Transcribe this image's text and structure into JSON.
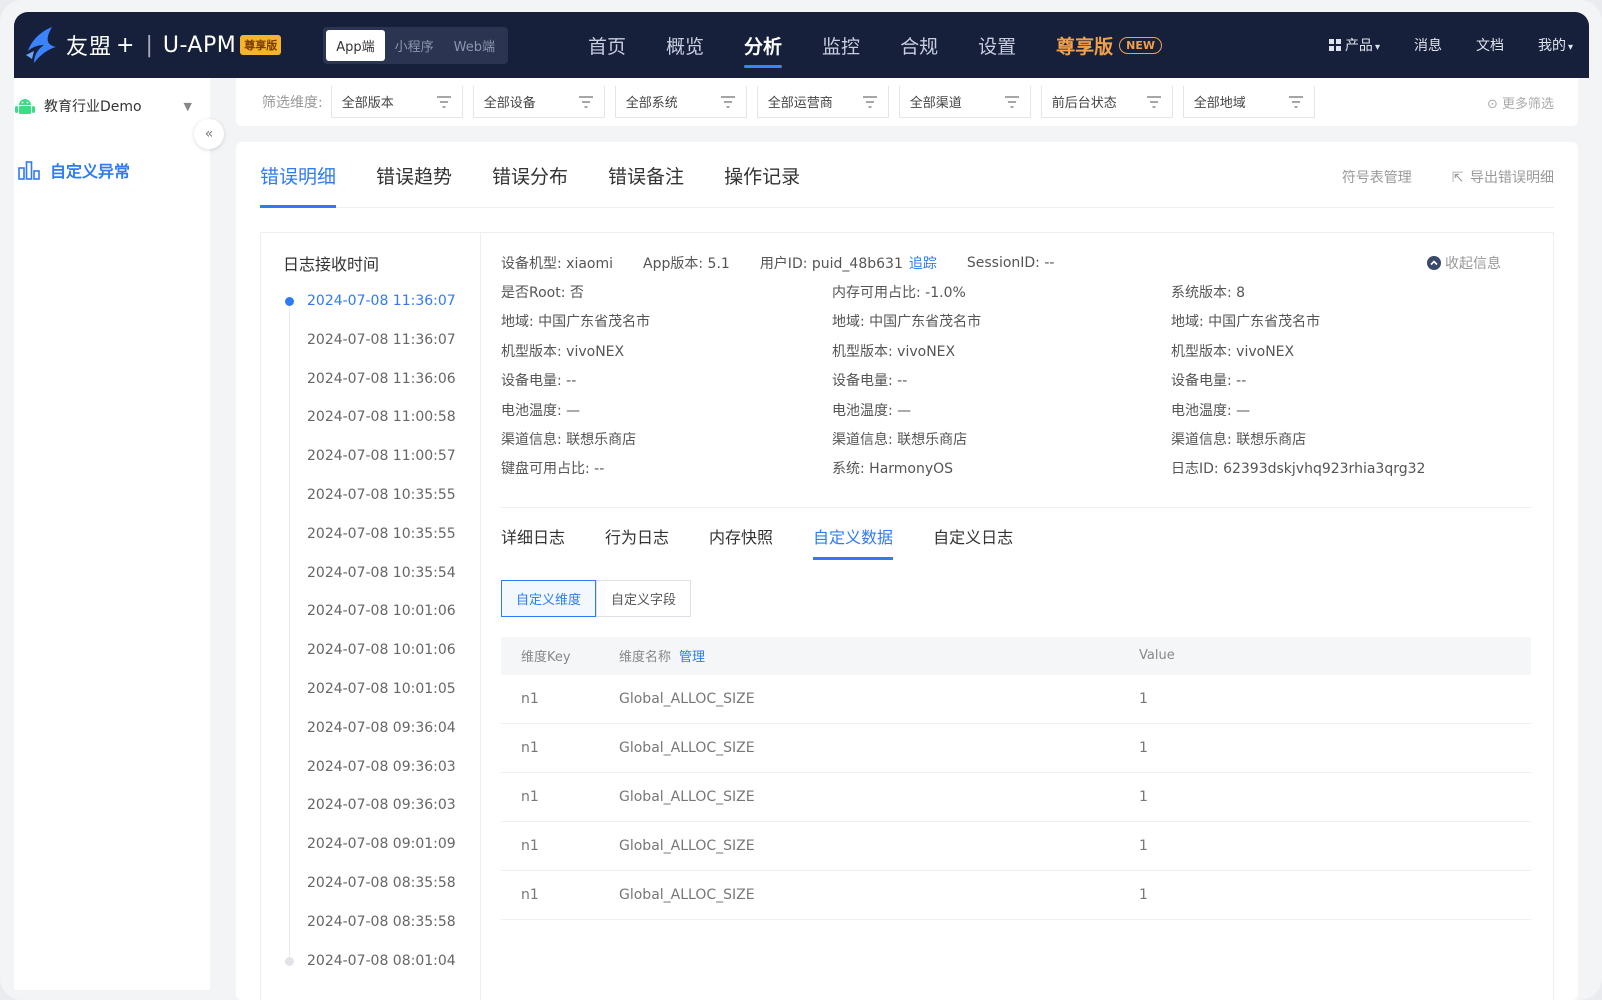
{
  "brand": {
    "name": "友盟",
    "plus": "+",
    "product": "U-APM",
    "badge": "尊享版"
  },
  "platforms": [
    "App端",
    "小程序",
    "Web端"
  ],
  "nav": {
    "items": [
      "首页",
      "概览",
      "分析",
      "监控",
      "合规",
      "设置"
    ],
    "vip": "尊享版",
    "vip_badge": "NEW",
    "right": [
      "产品",
      "消息",
      "文档",
      "我的"
    ]
  },
  "sidebar": {
    "app_name": "教育行业Demo",
    "menu_item": "自定义异常"
  },
  "filters": {
    "label": "筛选维度:",
    "items": [
      "全部版本",
      "全部设备",
      "全部系统",
      "全部运营商",
      "全部渠道",
      "前后台状态",
      "全部地域"
    ],
    "more": "更多筛选"
  },
  "tabs": {
    "items": [
      "错误明细",
      "错误趋势",
      "错误分布",
      "错误备注",
      "操作记录"
    ],
    "actions": [
      "符号表管理",
      "导出错误明细"
    ]
  },
  "time_list": {
    "title": "日志接收时间",
    "items": [
      "2024-07-08 11:36:07",
      "2024-07-08 11:36:07",
      "2024-07-08 11:36:06",
      "2024-07-08 11:00:58",
      "2024-07-08 11:00:57",
      "2024-07-08 10:35:55",
      "2024-07-08 10:35:55",
      "2024-07-08 10:35:54",
      "2024-07-08 10:01:06",
      "2024-07-08 10:01:06",
      "2024-07-08 10:01:05",
      "2024-07-08 09:36:04",
      "2024-07-08 09:36:03",
      "2024-07-08 09:36:03",
      "2024-07-08 09:01:09",
      "2024-07-08 08:35:58",
      "2024-07-08 08:35:58",
      "2024-07-08 08:01:04"
    ]
  },
  "detail": {
    "device_model": "设备机型: xiaomi",
    "app_version": "App版本: 5.1",
    "user_id": "用户ID: puid_48b631",
    "trace": "追踪",
    "session_id": "SessionID: --",
    "collapse": "收起信息",
    "grid": [
      "是否Root: 否",
      "内存可用占比: -1.0%",
      "系统版本: 8",
      "地域: 中国广东省茂名市",
      "地域: 中国广东省茂名市",
      "地域: 中国广东省茂名市",
      "机型版本: vivoNEX",
      "机型版本: vivoNEX",
      "机型版本: vivoNEX",
      "设备电量: --",
      "设备电量: --",
      "设备电量: --",
      "电池温度: —",
      "电池温度: —",
      "电池温度: —",
      "渠道信息: 联想乐商店",
      "渠道信息: 联想乐商店",
      "渠道信息: 联想乐商店",
      "键盘可用占比: --",
      "系统: HarmonyOS",
      "日志ID: 62393dskjvhq923rhia3qrg32"
    ]
  },
  "sub_tabs": [
    "详细日志",
    "行为日志",
    "内存快照",
    "自定义数据",
    "自定义日志"
  ],
  "segment": [
    "自定义维度",
    "自定义字段"
  ],
  "table": {
    "headers": {
      "key": "维度Key",
      "name": "维度名称",
      "manage": "管理",
      "value": "Value"
    },
    "rows": [
      {
        "key": "n1",
        "name": "Global_ALLOC_SIZE",
        "value": "1"
      },
      {
        "key": "n1",
        "name": "Global_ALLOC_SIZE",
        "value": "1"
      },
      {
        "key": "n1",
        "name": "Global_ALLOC_SIZE",
        "value": "1"
      },
      {
        "key": "n1",
        "name": "Global_ALLOC_SIZE",
        "value": "1"
      },
      {
        "key": "n1",
        "name": "Global_ALLOC_SIZE",
        "value": "1"
      }
    ]
  },
  "colors": {
    "brand_nav": "#16203a",
    "accent": "#2f7bf6",
    "vip": "#f0a14a",
    "badge": "#f4b52a"
  }
}
